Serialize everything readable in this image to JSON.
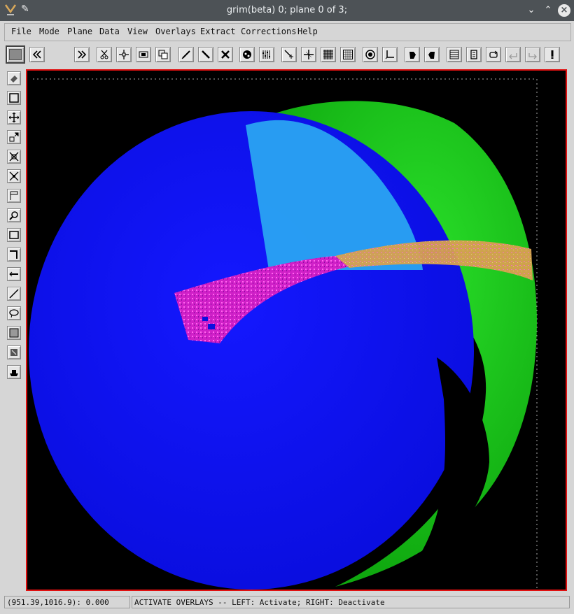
{
  "window": {
    "title": "grim(beta) 0;  plane 0 of 3;"
  },
  "menu": {
    "items": [
      "File",
      "Mode",
      "Plane",
      "Data",
      "View",
      "Overlays",
      "Extract",
      "Corrections",
      "Help"
    ]
  },
  "toolbar": {
    "plane_field_value": "",
    "icons": [
      "current-color-swatch",
      "previous-plane-icon",
      "next-plane-icon",
      "scissors-icon",
      "crosshair-icon",
      "zoom-box-icon",
      "copy-icon",
      "pen-icon",
      "line-icon",
      "x-mark-icon",
      "palette-icon",
      "sliders-icon",
      "point-add-icon",
      "grid-cross-icon",
      "dither-icon",
      "grid-dots-icon",
      "target-icon",
      "axes-icon",
      "hand-left-icon",
      "hand-right-icon",
      "table-icon",
      "document-icon",
      "loop-icon",
      "undo-icon",
      "redo-icon",
      "alert-icon"
    ]
  },
  "left_tools": {
    "icons": [
      "eraser-icon",
      "select-box-icon",
      "move-icon",
      "zoom-in-icon",
      "magnify-out-icon",
      "magnify-in-icon",
      "flag-icon",
      "search-icon",
      "rectangle-icon",
      "corner-icon",
      "pointer-icon",
      "diagonal-line-icon",
      "lasso-icon",
      "fill-box-icon",
      "stamp-icon",
      "ship-icon"
    ]
  },
  "image": {
    "description_colors": {
      "background": "#000000",
      "blue_sphere": "#0a10f0",
      "green_crescent": "#16c416",
      "cyan_overlap": "#22a8f0",
      "magenta_band": "#e020d0",
      "orange_band": "#e0a040"
    }
  },
  "status": {
    "coords": "(951.39,1016.9): 0.000",
    "message": "ACTIVATE OVERLAYS -- LEFT: Activate; RIGHT: Deactivate"
  },
  "colors": {
    "frame_border": "#e01010",
    "titlebar": "#4d5256"
  }
}
